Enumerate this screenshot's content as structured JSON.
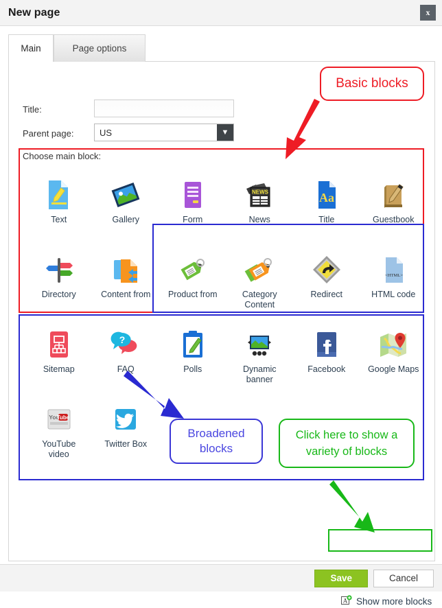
{
  "window": {
    "title": "New page",
    "close_icon": "close-icon",
    "close_label": "x"
  },
  "tabs": [
    {
      "label": "Main",
      "active": true
    },
    {
      "label": "Page options",
      "active": false
    }
  ],
  "form": {
    "title_label": "Title:",
    "title_value": "",
    "title_placeholder": "",
    "parent_label": "Parent page:",
    "parent_value": "US",
    "parent_caret_icon": "chevron-down-icon",
    "choose_label": "Choose main block:"
  },
  "blocks": [
    [
      {
        "label": "Text",
        "icon": "text-document-icon"
      },
      {
        "label": "Gallery",
        "icon": "gallery-image-icon"
      },
      {
        "label": "Form",
        "icon": "form-icon"
      },
      {
        "label": "News",
        "icon": "news-icon"
      },
      {
        "label": "Title",
        "icon": "title-aa-icon"
      },
      {
        "label": "Guestbook",
        "icon": "guestbook-icon"
      }
    ],
    [
      {
        "label": "Directory",
        "icon": "directory-signpost-icon"
      },
      {
        "label": "Content from",
        "icon": "content-from-icon"
      },
      {
        "label": "Product from",
        "icon": "product-tag-icon"
      },
      {
        "label": "Category\nContent",
        "icon": "category-tags-icon"
      },
      {
        "label": "Redirect",
        "icon": "redirect-sign-icon"
      },
      {
        "label": "HTML code",
        "icon": "html-code-icon"
      }
    ],
    [
      {
        "label": "Sitemap",
        "icon": "sitemap-icon"
      },
      {
        "label": "FAQ",
        "icon": "faq-bubbles-icon"
      },
      {
        "label": "Polls",
        "icon": "polls-clipboard-icon"
      },
      {
        "label": "Dynamic\nbanner",
        "icon": "dynamic-banner-icon"
      },
      {
        "label": "Facebook",
        "icon": "facebook-icon"
      },
      {
        "label": "Google Maps",
        "icon": "google-maps-icon"
      }
    ],
    [
      {
        "label": "YouTube\nvideo",
        "icon": "youtube-icon"
      },
      {
        "label": "Twitter Box",
        "icon": "twitter-icon"
      }
    ]
  ],
  "show_more": {
    "label": "Show more blocks",
    "icon": "add-block-icon"
  },
  "footer": {
    "save_label": "Save",
    "cancel_label": "Cancel"
  },
  "annotations": {
    "basic_blocks": "Basic blocks",
    "broadened_blocks": "Broadened\nblocks",
    "click_here": "Click here to show\na variety of blocks"
  },
  "colors": {
    "red": "#ee1c25",
    "blue": "#2a2ad1",
    "green": "#18b818",
    "save_green": "#8cc321"
  }
}
